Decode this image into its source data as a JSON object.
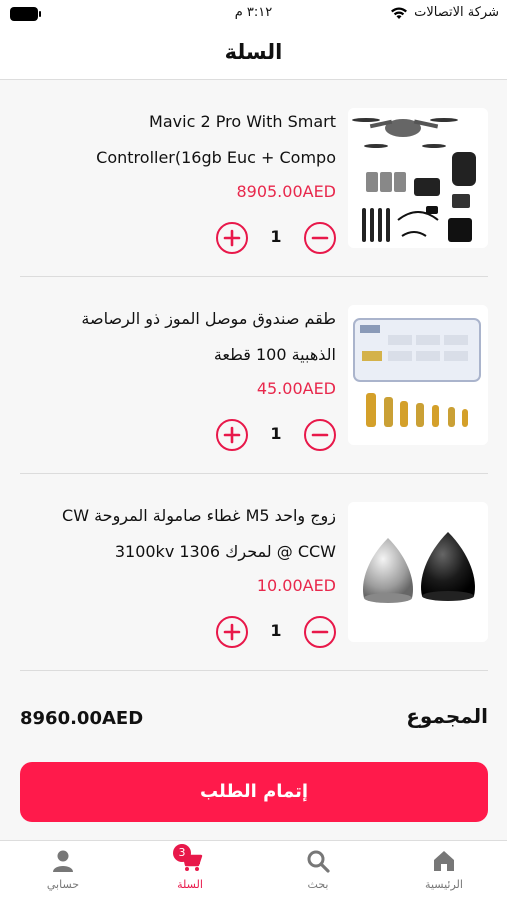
{
  "status_bar": {
    "carrier": "شركة الاتصالات",
    "time": "٣:١٢ م"
  },
  "header": {
    "title": "السلة"
  },
  "cart": {
    "items": [
      {
        "title_line1": "Mavic 2 Pro With Smart",
        "title_line2": "Controller(16gb Euc + Compo",
        "price": "8905.00AED",
        "quantity": "1"
      },
      {
        "title_line1": "طقم صندوق موصل الموز ذو الرصاصة",
        "title_line2": "الذهبية 100 قطعة",
        "price": "45.00AED",
        "quantity": "1"
      },
      {
        "title_line1": "زوج واحد M5 غطاء صامولة المروحة CW",
        "title_line2": "CCW @ لمحرك 1306 3100kv",
        "price": "10.00AED",
        "quantity": "1"
      }
    ]
  },
  "summary": {
    "total_label": "المجموع",
    "total_value": "8960.00AED"
  },
  "checkout": {
    "label": "إتمام الطلب"
  },
  "bottom_nav": {
    "home": "الرئيسية",
    "search": "بحث",
    "cart": "السلة",
    "cart_badge": "3",
    "account": "حسابي"
  },
  "colors": {
    "accent": "#e8184a",
    "price": "#e8284c",
    "checkout_bg": "#ff1a4b"
  }
}
